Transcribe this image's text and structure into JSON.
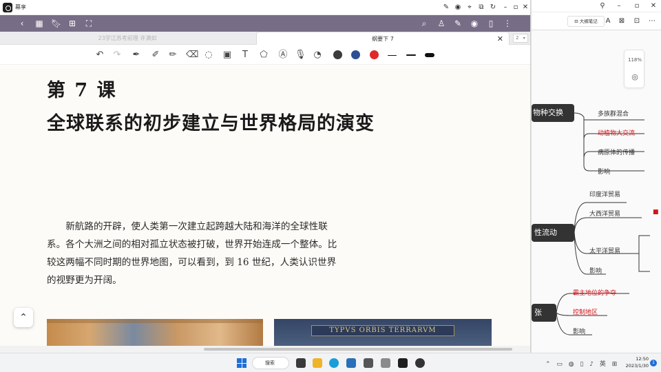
{
  "app": {
    "name": "幕享"
  },
  "colors": {
    "nav_bg": "#786d86",
    "pen_black": "#3b3b3b",
    "pen_blue": "#2e4f93",
    "pen_red": "#e02a2a",
    "mindmap_red": "#d0171b",
    "mindmap_node": "#333333"
  },
  "tabs": {
    "items": [
      "23学江苏考前理 许满如",
      "纲要下 7"
    ],
    "count": "2"
  },
  "toolbar": {
    "icons": [
      "undo-icon",
      "redo-icon",
      "pen-icon",
      "marker-icon",
      "highlighter-icon",
      "eraser-icon",
      "lasso-icon",
      "image-icon",
      "text-icon",
      "shape-icon",
      "ocr-icon",
      "mic-icon",
      "timer-icon"
    ],
    "pen_colors": [
      "black",
      "blue",
      "red"
    ]
  },
  "page": {
    "lesson_number": "第 7 课",
    "lesson_title": "全球联系的初步建立与世界格局的演变",
    "intro": "新航路的开辟，使人类第一次建立起跨越大陆和海洋的全球性联系。各个大洲之间的相对孤立状态被打破，世界开始连成一个整体。比较这两幅不同时期的世界地图，可以看到，到 16 世纪，人类认识世界的视野更为开阔。",
    "map_right_title": "TYPVS ORBIS TERRARVM"
  },
  "mindmap": {
    "app_label": "大纲笔记",
    "zoom": "118%",
    "nodes": [
      {
        "label": "物种交换",
        "children": [
          "多族群混合",
          "动植物大交流",
          "病原体的传播",
          "影响"
        ],
        "red_children": [
          "动植物大交流"
        ]
      },
      {
        "label": "性流动",
        "children": [
          "印度洋贸易",
          "大西洋贸易",
          "太平洋贸易",
          "影响"
        ]
      },
      {
        "label": "张",
        "children": [
          "霸主地位的争夺",
          "控制地区",
          "影响"
        ],
        "red_children": [
          "霸主地位的争夺",
          "控制地区"
        ]
      }
    ]
  },
  "taskbar": {
    "search_label": "搜索",
    "time": "12:50",
    "date": "2023/1/30",
    "notifications": "1",
    "lang": "英"
  }
}
